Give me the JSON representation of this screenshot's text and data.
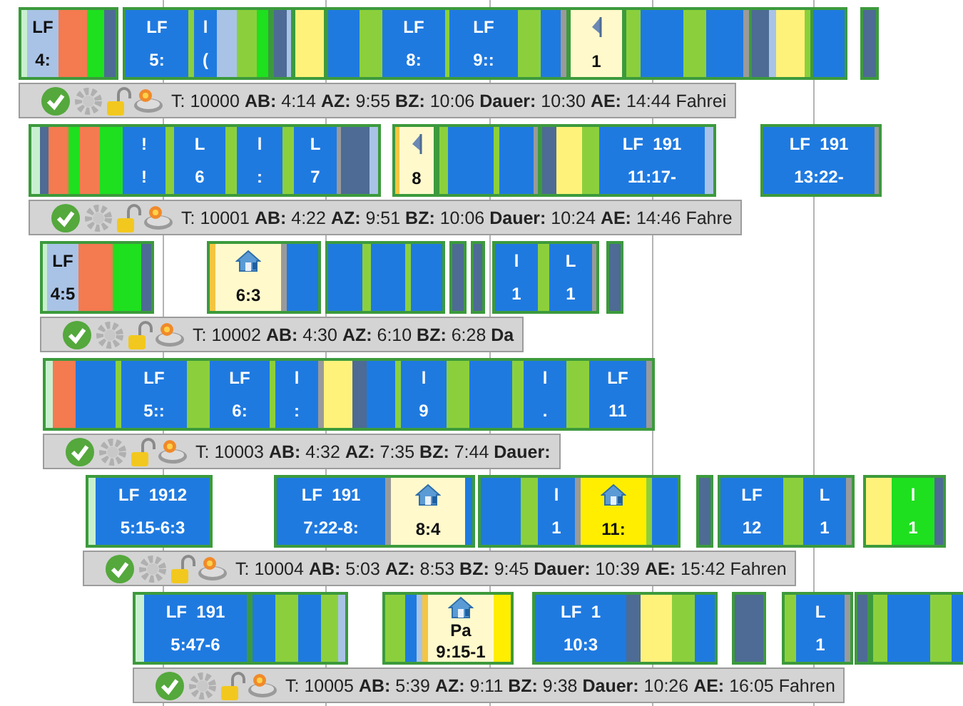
{
  "tours": [
    {
      "summary": "T: 10000 **AB:** 4:14 **AZ:** 9:55 **BZ:** 10:06 **Dauer:** 10:30 **AE:** 14:44 Fahrei",
      "blocks": [
        {
          "segments": [
            {
              "color": "#c8f0d0"
            },
            {
              "color": "#a9c3e6",
              "lines": [
                "LF",
                "4:"
              ]
            },
            {
              "color": "#f47a50"
            },
            {
              "color": "#1ee01e"
            },
            {
              "color": "#4d6b94"
            }
          ]
        },
        {
          "segments": [
            {
              "color": "#1f7ae0",
              "lines": [
                "LF",
                "5:"
              ]
            },
            {
              "color": "#8bd03c"
            },
            {
              "color": "#1f7ae0",
              "lines": [
                "l",
                "("
              ]
            },
            {
              "color": "#a9c3e6"
            },
            {
              "color": "#8bd03c"
            },
            {
              "color": "#1ee01e"
            }
          ]
        },
        {
          "segments": [
            {
              "color": "#4d6b94"
            },
            {
              "color": "#a9c3e6"
            }
          ]
        },
        {
          "segments": [
            {
              "color": "#fff27a"
            }
          ]
        },
        {
          "segments": [
            {
              "color": "#1f7ae0"
            },
            {
              "color": "#8bd03c"
            },
            {
              "color": "#1f7ae0",
              "lines": [
                "LF",
                "8:"
              ]
            },
            {
              "color": "#8bd03c"
            },
            {
              "color": "#1f7ae0",
              "lines": [
                "LF",
                "9::"
              ]
            },
            {
              "color": "#8bd03c"
            },
            {
              "color": "#1f7ae0"
            },
            {
              "color": "#9a9a9a"
            }
          ]
        },
        {
          "segments": [
            {
              "color": "#fff9cc",
              "kind": "pennant",
              "lines": [
                "1"
              ]
            }
          ]
        },
        {
          "segments": [
            {
              "color": "#8bd03c"
            },
            {
              "color": "#1f7ae0"
            },
            {
              "color": "#8bd03c"
            },
            {
              "color": "#1f7ae0"
            },
            {
              "color": "#9a9a9a"
            }
          ]
        },
        {
          "segments": [
            {
              "color": "#4d6b94"
            },
            {
              "color": "#a9c3e6"
            },
            {
              "color": "#fff27a"
            },
            {
              "color": "#8bd03c"
            }
          ]
        },
        {
          "segments": [
            {
              "color": "#1f7ae0"
            }
          ]
        },
        {
          "segments": [
            {
              "color": "#4d6b94"
            }
          ]
        }
      ]
    },
    {
      "summary": "T: 10001 **AB:** 4:22 **AZ:** 9:51 **BZ:** 10:06 **Dauer:** 10:24 **AE:** 14:46 Fahre",
      "blocks": [
        {
          "segments": [
            {
              "color": "#c8f0d0"
            },
            {
              "color": "#4d6b94"
            },
            {
              "color": "#f47a50"
            },
            {
              "color": "#1ee01e"
            },
            {
              "color": "#f47a50"
            },
            {
              "color": "#1ee01e"
            },
            {
              "color": "#1f7ae0",
              "lines": [
                "!",
                "!"
              ]
            },
            {
              "color": "#8bd03c"
            },
            {
              "color": "#1f7ae0",
              "lines": [
                "L",
                "6"
              ]
            },
            {
              "color": "#8bd03c"
            },
            {
              "color": "#1f7ae0",
              "lines": [
                "l",
                ":"
              ]
            },
            {
              "color": "#8bd03c"
            },
            {
              "color": "#1f7ae0",
              "lines": [
                "L",
                "7"
              ]
            },
            {
              "color": "#9a9a9a"
            },
            {
              "color": "#4d6b94"
            },
            {
              "color": "#a9c3e6"
            }
          ]
        },
        {
          "segments": [
            {
              "color": "#f5c542"
            },
            {
              "color": "#fff9cc",
              "kind": "pennant",
              "lines": [
                "8"
              ]
            }
          ]
        },
        {
          "segments": [
            {
              "color": "#8bd03c"
            },
            {
              "color": "#1f7ae0"
            },
            {
              "color": "#8bd03c"
            },
            {
              "color": "#1f7ae0"
            },
            {
              "color": "#9a9a9a"
            }
          ]
        },
        {
          "segments": [
            {
              "color": "#4d6b94"
            },
            {
              "color": "#fff27a"
            },
            {
              "color": "#8bd03c"
            },
            {
              "color": "#1f7ae0",
              "lines": [
                "LF  191",
                "11:17-"
              ]
            },
            {
              "color": "#a9c3e6"
            }
          ]
        },
        {
          "segments": [
            {
              "color": "#1f7ae0",
              "lines": [
                "LF  191",
                "13:22-"
              ]
            },
            {
              "color": "#9a9a9a"
            }
          ]
        }
      ]
    },
    {
      "summary": "T: 10002 **AB:** 4:30 **AZ:** 6:10 **BZ:** 6:28 **Da**",
      "blocks": [
        {
          "segments": [
            {
              "color": "#c8f0d0"
            },
            {
              "color": "#a9c3e6",
              "lines": [
                "LF",
                "4:5"
              ]
            },
            {
              "color": "#f47a50"
            },
            {
              "color": "#1ee01e"
            },
            {
              "color": "#4d6b94"
            }
          ]
        },
        {
          "segments": [
            {
              "color": "#f5c542"
            },
            {
              "color": "#fff9cc",
              "kind": "house",
              "lines": [
                "6:3"
              ]
            },
            {
              "color": "#9a9a9a"
            },
            {
              "color": "#1f7ae0"
            }
          ]
        },
        {
          "segments": [
            {
              "color": "#1f7ae0"
            },
            {
              "color": "#8bd03c"
            },
            {
              "color": "#1f7ae0"
            },
            {
              "color": "#8bd03c"
            },
            {
              "color": "#1f7ae0"
            }
          ]
        },
        {
          "segments": [
            {
              "color": "#4d6b94"
            }
          ]
        },
        {
          "segments": [
            {
              "color": "#4d6b94"
            }
          ]
        },
        {
          "segments": [
            {
              "color": "#1f7ae0",
              "lines": [
                "l",
                "1"
              ]
            },
            {
              "color": "#8bd03c"
            },
            {
              "color": "#1f7ae0",
              "lines": [
                "L",
                "1"
              ]
            },
            {
              "color": "#9a9a9a"
            }
          ]
        },
        {
          "segments": [
            {
              "color": "#4d6b94"
            }
          ]
        }
      ]
    },
    {
      "summary": "T: 10003 **AB:** 4:32 **AZ:** 7:35 **BZ:** 7:44 **Dauer:**",
      "blocks": [
        {
          "segments": [
            {
              "color": "#c8f0d0"
            },
            {
              "color": "#f47a50"
            },
            {
              "color": "#1f7ae0"
            },
            {
              "color": "#8bd03c"
            },
            {
              "color": "#1f7ae0",
              "lines": [
                "LF",
                "5::"
              ]
            },
            {
              "color": "#8bd03c"
            },
            {
              "color": "#1f7ae0",
              "lines": [
                "LF",
                "6:"
              ]
            },
            {
              "color": "#8bd03c"
            },
            {
              "color": "#1f7ae0",
              "lines": [
                "l",
                ":"
              ]
            },
            {
              "color": "#9a9a9a"
            },
            {
              "color": "#fff27a"
            },
            {
              "color": "#4d6b94"
            },
            {
              "color": "#1f7ae0"
            },
            {
              "color": "#8bd03c"
            },
            {
              "color": "#1f7ae0",
              "lines": [
                "l",
                "9"
              ]
            },
            {
              "color": "#8bd03c"
            },
            {
              "color": "#1f7ae0"
            },
            {
              "color": "#8bd03c"
            },
            {
              "color": "#1f7ae0",
              "lines": [
                "l",
                "."
              ]
            },
            {
              "color": "#8bd03c"
            },
            {
              "color": "#1f7ae0",
              "lines": [
                "LF",
                "11"
              ]
            },
            {
              "color": "#9a9a9a"
            }
          ]
        }
      ]
    },
    {
      "summary": "T: 10004 **AB:** 5:03 **AZ:** 8:53 **BZ:** 9:45 **Dauer:** 10:39 **AE:** 15:42 Fahren",
      "blocks": [
        {
          "segments": [
            {
              "color": "#c8f0d0"
            },
            {
              "color": "#1f7ae0",
              "lines": [
                "LF  1912",
                "5:15-6:3"
              ]
            }
          ]
        },
        {
          "segments": [
            {
              "color": "#1f7ae0",
              "lines": [
                "LF  191",
                "7:22-8:"
              ]
            },
            {
              "color": "#9a9a9a"
            },
            {
              "color": "#fff9cc",
              "kind": "house",
              "lines": [
                "8:4"
              ]
            },
            {
              "color": "#1f7ae0"
            }
          ]
        },
        {
          "segments": [
            {
              "color": "#1f7ae0"
            },
            {
              "color": "#8bd03c"
            },
            {
              "color": "#1f7ae0",
              "lines": [
                "l",
                "1"
              ]
            },
            {
              "color": "#9a9a9a"
            },
            {
              "color": "#ffee00",
              "kind": "house",
              "lines": [
                "11:"
              ]
            },
            {
              "color": "#8bd03c"
            },
            {
              "color": "#1f7ae0"
            }
          ]
        },
        {
          "segments": [
            {
              "color": "#4d6b94"
            }
          ]
        },
        {
          "segments": [
            {
              "color": "#1f7ae0",
              "lines": [
                "LF",
                "12"
              ]
            },
            {
              "color": "#8bd03c"
            },
            {
              "color": "#1f7ae0",
              "lines": [
                "L",
                "1"
              ]
            },
            {
              "color": "#9a9a9a"
            }
          ]
        },
        {
          "segments": [
            {
              "color": "#fff27a"
            },
            {
              "color": "#1ee01e",
              "lines": [
                "l",
                "1"
              ]
            },
            {
              "color": "#4d6b94"
            }
          ]
        }
      ]
    },
    {
      "summary": "T: 10005 **AB:** 5:39 **AZ:** 9:11 **BZ:** 9:38 **Dauer:** 10:26 **AE:** 16:05 Fahren",
      "blocks": [
        {
          "segments": [
            {
              "color": "#c8f0d0"
            },
            {
              "color": "#1f7ae0",
              "lines": [
                "LF  191",
                "5:47-6"
              ]
            }
          ]
        },
        {
          "segments": [
            {
              "color": "#1f7ae0"
            },
            {
              "color": "#8bd03c"
            },
            {
              "color": "#1f7ae0"
            },
            {
              "color": "#8bd03c"
            },
            {
              "color": "#a9c3e6"
            }
          ]
        },
        {
          "segments": [
            {
              "color": "#8bd03c"
            },
            {
              "color": "#1f7ae0"
            },
            {
              "color": "#a9c3e6"
            },
            {
              "color": "#f5c542"
            },
            {
              "color": "#fff9cc",
              "kind": "house",
              "lines": [
                "Pa",
                "9:15-1"
              ]
            },
            {
              "color": "#ffee00"
            }
          ]
        },
        {
          "segments": [
            {
              "color": "#1f7ae0",
              "lines": [
                "LF  1",
                "10:3"
              ]
            },
            {
              "color": "#4d6b94"
            },
            {
              "color": "#fff27a"
            },
            {
              "color": "#8bd03c"
            },
            {
              "color": "#1f7ae0"
            }
          ]
        },
        {
          "segments": [
            {
              "color": "#4d6b94"
            }
          ]
        },
        {
          "segments": [
            {
              "color": "#8bd03c"
            },
            {
              "color": "#1f7ae0",
              "lines": [
                "L",
                "1"
              ]
            },
            {
              "color": "#9a9a9a"
            }
          ]
        },
        {
          "segments": [
            {
              "color": "#4d6b94"
            }
          ]
        },
        {
          "segments": [
            {
              "color": "#8bd03c"
            },
            {
              "color": "#1f7ae0"
            },
            {
              "color": "#8bd03c"
            },
            {
              "color": "#1f7ae0"
            }
          ]
        }
      ]
    }
  ]
}
